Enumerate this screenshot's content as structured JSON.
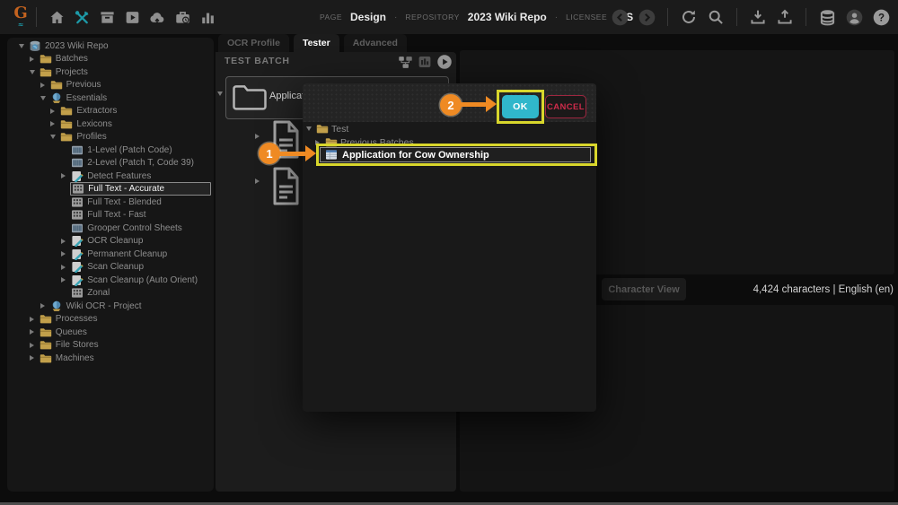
{
  "topbar": {
    "logo_text": "G",
    "left_icons": [
      "home",
      "tools",
      "archive-box",
      "play-box",
      "cloud-upload",
      "briefcase-clock",
      "bar-chart"
    ],
    "context": {
      "page_label": "PAGE",
      "page_value": "Design",
      "repo_label": "REPOSITORY",
      "repo_value": "2023 Wiki Repo",
      "licensee_label": "LICENSEE",
      "licensee_value": "BIS",
      "separator": "·"
    },
    "right_icon_groups": [
      [
        "back-circle",
        "forward-circle"
      ],
      [
        "refresh",
        "search"
      ],
      [
        "download",
        "upload"
      ],
      [
        "database",
        "user",
        "help"
      ]
    ]
  },
  "sidebar": {
    "tree": [
      {
        "label": "2023 Wiki Repo",
        "level": 0,
        "icon": "repo",
        "caret": "down"
      },
      {
        "label": "Batches",
        "level": 1,
        "icon": "folder",
        "caret": "right"
      },
      {
        "label": "Projects",
        "level": 1,
        "icon": "folder",
        "caret": "down"
      },
      {
        "label": "Previous",
        "level": 2,
        "icon": "folder",
        "caret": "right"
      },
      {
        "label": "Essentials",
        "level": 2,
        "icon": "project",
        "caret": "down"
      },
      {
        "label": "Extractors",
        "level": 3,
        "icon": "folder",
        "caret": "right"
      },
      {
        "label": "Lexicons",
        "level": 3,
        "icon": "folder",
        "caret": "right"
      },
      {
        "label": "Profiles",
        "level": 3,
        "icon": "folder",
        "caret": "down"
      },
      {
        "label": "1-Level (Patch Code)",
        "level": 4,
        "icon": "barcode",
        "caret": ""
      },
      {
        "label": "2-Level (Patch T, Code 39)",
        "level": 4,
        "icon": "barcode",
        "caret": ""
      },
      {
        "label": "Detect Features",
        "level": 4,
        "icon": "pencil",
        "caret": "right"
      },
      {
        "label": "Full Text - Accurate",
        "level": 4,
        "icon": "ocr",
        "caret": "",
        "selected": true
      },
      {
        "label": "Full Text - Blended",
        "level": 4,
        "icon": "ocr",
        "caret": ""
      },
      {
        "label": "Full Text - Fast",
        "level": 4,
        "icon": "ocr",
        "caret": ""
      },
      {
        "label": "Grooper Control Sheets",
        "level": 4,
        "icon": "barcode",
        "caret": ""
      },
      {
        "label": "OCR Cleanup",
        "level": 4,
        "icon": "pencil",
        "caret": "right"
      },
      {
        "label": "Permanent Cleanup",
        "level": 4,
        "icon": "pencil",
        "caret": "right"
      },
      {
        "label": "Scan Cleanup",
        "level": 4,
        "icon": "pencil",
        "caret": "right"
      },
      {
        "label": "Scan Cleanup (Auto Orient)",
        "level": 4,
        "icon": "pencil",
        "caret": "right"
      },
      {
        "label": "Zonal",
        "level": 4,
        "icon": "ocr",
        "caret": ""
      },
      {
        "label": "Wiki OCR - Project",
        "level": 2,
        "icon": "project",
        "caret": "right"
      },
      {
        "label": "Processes",
        "level": 1,
        "icon": "folder",
        "caret": "right"
      },
      {
        "label": "Queues",
        "level": 1,
        "icon": "folder",
        "caret": "right"
      },
      {
        "label": "File Stores",
        "level": 1,
        "icon": "folder",
        "caret": "right"
      },
      {
        "label": "Machines",
        "level": 1,
        "icon": "folder",
        "caret": "right"
      }
    ]
  },
  "tester": {
    "tabs": [
      {
        "label": "OCR Profile",
        "active": false
      },
      {
        "label": "Tester",
        "active": true
      },
      {
        "label": "Advanced",
        "active": false
      }
    ],
    "header": "TEST BATCH",
    "header_icons": [
      "hierarchy",
      "stats",
      "play"
    ],
    "root_label": "Applicati",
    "doc_count": 2
  },
  "dialog": {
    "ok_label": "OK",
    "cancel_label": "CANCEL",
    "tree": [
      {
        "label": "Test",
        "icon": "folder",
        "caret": "down"
      },
      {
        "label": "Previous Batches",
        "icon": "folder",
        "caret": "right",
        "dim": true
      },
      {
        "label": "Application for Cow Ownership",
        "icon": "batch",
        "selected": true
      }
    ]
  },
  "viewer": {
    "tab_label": "Character View",
    "stats": "4,424 characters | English (en)"
  },
  "annotations": {
    "step1": "1",
    "step2": "2"
  },
  "colors": {
    "ok_button": "#30b7cb",
    "cancel_text": "#cd2b4a",
    "highlight_outline": "#d8d62c",
    "annotation_orange": "#ef8a23",
    "folder_yellow": "#c2a04b"
  }
}
